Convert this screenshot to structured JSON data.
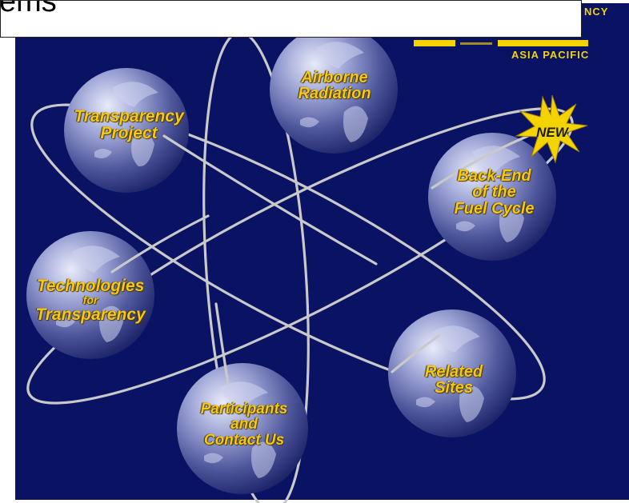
{
  "header": {
    "title_fragment": "ems",
    "brand_word": "NCY",
    "brand_subtitle": "Asia Pacific"
  },
  "globes": [
    {
      "id": "transparency-project",
      "lines": [
        "Transparency",
        "Project"
      ]
    },
    {
      "id": "airborne-radiation",
      "lines": [
        "Airborne",
        "Radiation"
      ]
    },
    {
      "id": "back-end-fuel-cycle",
      "lines": [
        "Back-End",
        "of the",
        "Fuel Cycle"
      ]
    },
    {
      "id": "technologies-for-transparency",
      "lines": [
        "Technologies",
        "for",
        "Transparency"
      ]
    },
    {
      "id": "related-sites",
      "lines": [
        "Related",
        "Sites"
      ]
    },
    {
      "id": "participants-contact-us",
      "lines": [
        "Participants",
        "and",
        "Contact Us"
      ]
    }
  ],
  "new_badge": "NEW",
  "colors": {
    "background": "#0a1263",
    "label": "#f7c712",
    "brand": "#f3d400",
    "orbit": "#c9c9c9"
  }
}
